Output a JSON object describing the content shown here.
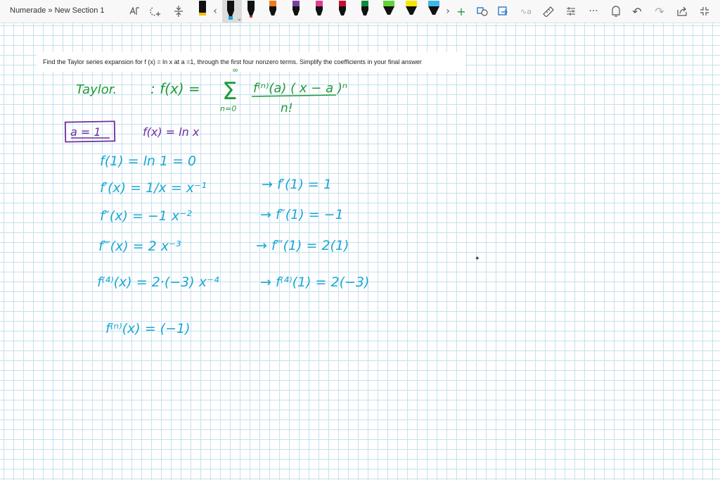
{
  "app": {
    "breadcrumb": "Numerade » New Section 1"
  },
  "toolbar": {
    "icons": [
      "lasso-select-icon",
      "add-space-icon",
      "insert-space-icon",
      "pen-icon",
      "chevron-left-icon",
      "chevron-right-icon",
      "add-pen-icon",
      "ink-to-shape-icon",
      "ink-to-text-icon",
      "ink-to-math-icon",
      "ruler-icon",
      "more-pens-icon",
      "more-icon",
      "replay-icon",
      "undo-icon",
      "redo-icon",
      "share-icon",
      "fullscreen-icon"
    ],
    "pen_colors": [
      "#111111",
      "#f2c200",
      "#111111",
      "#1da1d6",
      "#d22a1e",
      "#ef7c1c",
      "#7b3fa0",
      "#e23d8f",
      "#c8102e",
      "#0f8a3c",
      "#5ab82e",
      "#62d13a",
      "#f6e600",
      "#ffd000",
      "#3fb6e8",
      "#b07fd6"
    ],
    "grid_color": "#c6e0ee"
  },
  "page": {
    "question": "Find the Taylor series expansion for f (x) = ln x at a =1, through the first four nonzero terms. Simplify the coefficients in your final answer"
  },
  "ink": {
    "colors": {
      "green": "#1f9a3a",
      "purple": "#6b2fa0",
      "cyan": "#1ba8d4"
    },
    "taylor_label": "Taylor.",
    "taylor_formula_lhs": ": f(x) =",
    "sum_upper": "∞",
    "sum_lower": "n=0",
    "numerator": "f⁽ⁿ⁾(a) ( x − a )ⁿ",
    "denominator": "n!",
    "a_box": "a = 1",
    "f_def": "f(x) = ln x",
    "lines": [
      {
        "left": "f(1) = ln 1 = 0",
        "right": ""
      },
      {
        "left": "f′(x) = 1/x = x⁻¹",
        "right": "→ f′(1) = 1"
      },
      {
        "left": "f″(x) = −1 x⁻²",
        "right": "→ f″(1) = −1"
      },
      {
        "left": "f‴(x) = 2 x⁻³",
        "right": "→ f‴(1) = 2(1)"
      },
      {
        "left": "f⁽⁴⁾(x) = 2·(−3) x⁻⁴",
        "right": "→ f⁽⁴⁾(1) = 2(−3)"
      },
      {
        "left": "f⁽ⁿ⁾(x) = (−1)",
        "right": ""
      }
    ]
  }
}
